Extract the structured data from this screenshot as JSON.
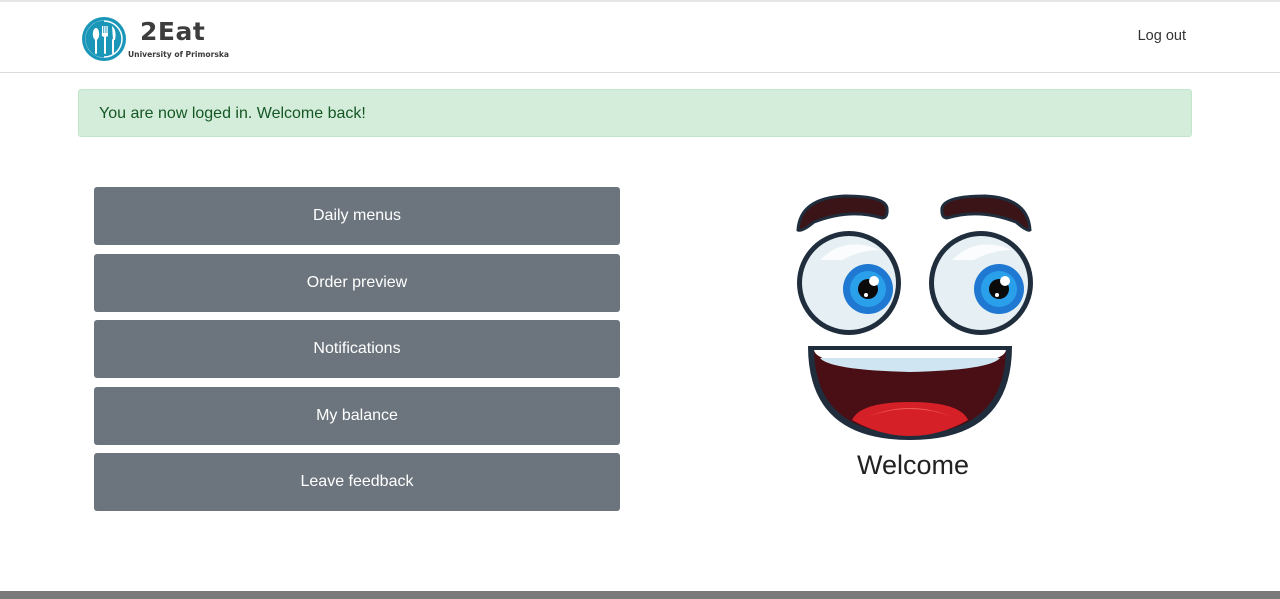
{
  "header": {
    "brand_name": "2Eat",
    "brand_subtitle": "University of Primorska",
    "logo_icon": "fork-spoon-logo-icon",
    "logout_label": "Log out"
  },
  "alert": {
    "message": "You are now loged in. Welcome back!",
    "type": "success"
  },
  "menu": {
    "items": [
      {
        "label": "Daily menus"
      },
      {
        "label": "Order preview"
      },
      {
        "label": "Notifications"
      },
      {
        "label": "My balance"
      },
      {
        "label": "Leave feedback"
      }
    ]
  },
  "hero": {
    "image_icon": "smiling-face-icon",
    "caption": "Welcome"
  },
  "colors": {
    "brand_teal": "#1a96b8",
    "button_gray": "#6c757d",
    "alert_bg": "#d4edda",
    "alert_text": "#155724"
  }
}
